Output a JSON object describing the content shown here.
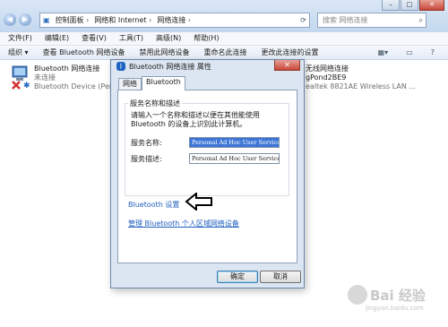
{
  "window": {
    "address_crumbs": [
      "控制面板",
      "网络和 Internet",
      "网络连接"
    ],
    "search_placeholder": "搜索 网络连接",
    "minimize": "–",
    "maximize": "□",
    "close": "✕"
  },
  "menu": [
    "文件(F)",
    "编辑(E)",
    "查看(V)",
    "工具(T)",
    "高级(N)",
    "帮助(H)"
  ],
  "toolbar": {
    "items": [
      "组织 ▾",
      "查看 Bluetooth 网络设备",
      "禁用此网络设备",
      "重命名此连接",
      "更改此连接的设置"
    ]
  },
  "connections": {
    "bluetooth": {
      "name": "Bluetooth 网络连接",
      "status": "未连接",
      "device": "Bluetooth Device (Personal Area ..."
    },
    "wireless": {
      "name": "无线网络连接",
      "status": "gPond2BE9",
      "device": "ealtek 8821AE Wireless LAN ..."
    }
  },
  "dialog": {
    "title": "Bluetooth 网络连接 属性",
    "close": "✕",
    "tabs": [
      "网络",
      "Bluetooth"
    ],
    "group_title": "服务名称和描述",
    "description": "请输入一个名称和描述以便在其他能使用 Bluetooth 的设备上识别此计算机。",
    "service_name_label": "服务名称:",
    "service_name_value": "Personal Ad Hoc User Service",
    "service_desc_label": "服务描述:",
    "service_desc_value": "Personal Ad Hoc User Service",
    "bluetooth_settings_link": "Bluetooth 设置",
    "manage_link": "管理 Bluetooth 个人区域网络设备",
    "ok": "确定",
    "cancel": "取消"
  },
  "watermark": {
    "brand": "Bai 经验",
    "url": "jingyan.baidu.com"
  }
}
